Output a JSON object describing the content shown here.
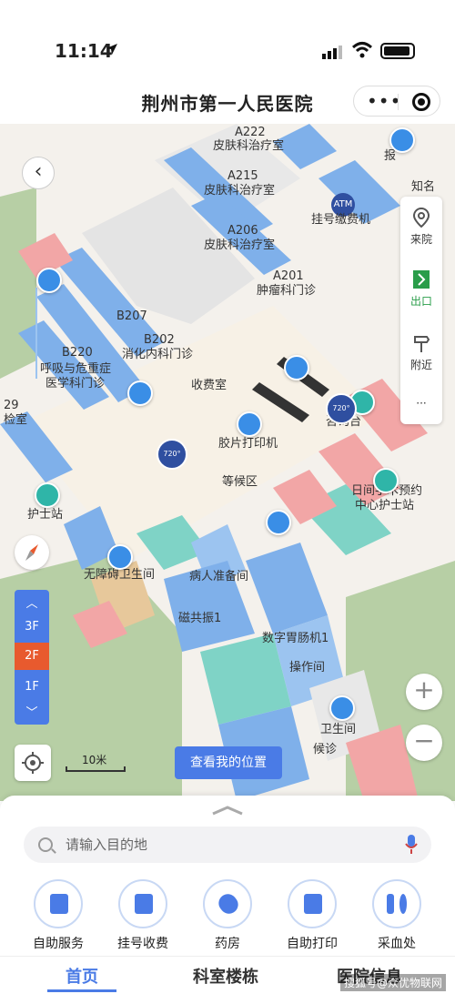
{
  "status_bar": {
    "time": "11:14"
  },
  "header": {
    "title": "荆州市第一人民医院"
  },
  "map": {
    "labels": {
      "a222_code": "A222",
      "a222_name": "皮肤科治疗室",
      "a215_code": "A215",
      "a215_name": "皮肤科治疗室",
      "atm": "ATM",
      "registration_machine": "挂号缴费机",
      "a206_code": "A206",
      "a206_name": "皮肤科治疗室",
      "a201_code": "A201",
      "a201_name": "肿瘤科门诊",
      "b207_code": "B207",
      "b202_code": "B202",
      "b202_name": "消化内科门诊",
      "b220_code": "B220",
      "b220_name_1": "呼吸与危重症",
      "b220_name_2": "医学科门诊",
      "cashier": "收费室",
      "consult_desk": "咨询台",
      "film_print": "胶片打印机",
      "waiting_area": "等候区",
      "day_surgery_1": "日间手术预约",
      "day_surgery_2": "中心护士站",
      "nurse_station": "护士站",
      "accessible_toilet": "无障碍卫生间",
      "patient_prep": "病人准备间",
      "mri": "磁共振1",
      "digital_gi": "数字胃肠机1",
      "operation_room": "操作间",
      "toilet": "卫生间",
      "waiting_clinic": "候诊",
      "report_partial": "报",
      "exam_partial": "检室",
      "edge_num": "29",
      "edge_right": "知名"
    },
    "vr_label": "720°",
    "side_panel": {
      "arrive": "来院",
      "exit": "出口",
      "nearby": "附近",
      "more": "···"
    },
    "floors": [
      "3F",
      "2F",
      "1F"
    ],
    "active_floor": "2F",
    "scale_label": "10米",
    "my_location_button": "查看我的位置",
    "zoom_in": "+",
    "zoom_out": "−"
  },
  "search": {
    "placeholder": "请输入目的地"
  },
  "services": [
    {
      "label": "自助服务",
      "icon": "self-service-icon"
    },
    {
      "label": "挂号收费",
      "icon": "registration-icon"
    },
    {
      "label": "药房",
      "icon": "pharmacy-icon"
    },
    {
      "label": "自助打印",
      "icon": "printer-icon"
    },
    {
      "label": "采血处",
      "icon": "blood-draw-icon"
    }
  ],
  "tabs": [
    {
      "label": "首页"
    },
    {
      "label": "科室楼栋"
    },
    {
      "label": "医院信息"
    }
  ],
  "colors": {
    "accent": "#4a7be6",
    "active_floor": "#e85a2e",
    "room_blue": "#7fb0ea",
    "room_teal": "#7fd3c6"
  },
  "watermark": "搜狐号@众优物联网"
}
